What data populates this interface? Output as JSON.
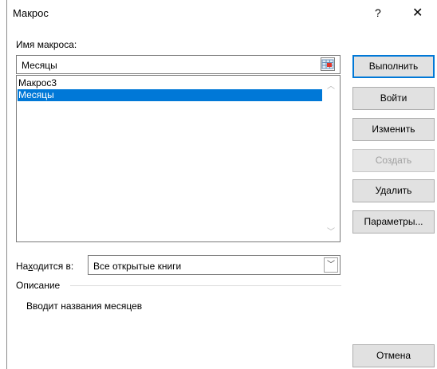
{
  "window": {
    "title": "Макрос",
    "help_glyph": "?",
    "close_glyph": "✕"
  },
  "macro_name": {
    "label": "Имя макроса:",
    "value": "Месяцы"
  },
  "macro_list": {
    "items": [
      "Макрос3",
      "Месяцы"
    ],
    "selected_index": 1
  },
  "location": {
    "label": "Находится в:",
    "value": "Все открытые книги"
  },
  "description": {
    "label": "Описание",
    "text": "Вводит названия месяцев"
  },
  "buttons": {
    "run": "Выполнить",
    "step_into": "Войти",
    "edit": "Изменить",
    "create": "Создать",
    "delete": "Удалить",
    "options": "Параметры...",
    "cancel": "Отмена"
  },
  "icons": {
    "ref": "reference-picker-icon",
    "scroll_up": "chevron-up-icon",
    "scroll_down": "chevron-down-icon",
    "combo": "chevron-down-icon"
  }
}
